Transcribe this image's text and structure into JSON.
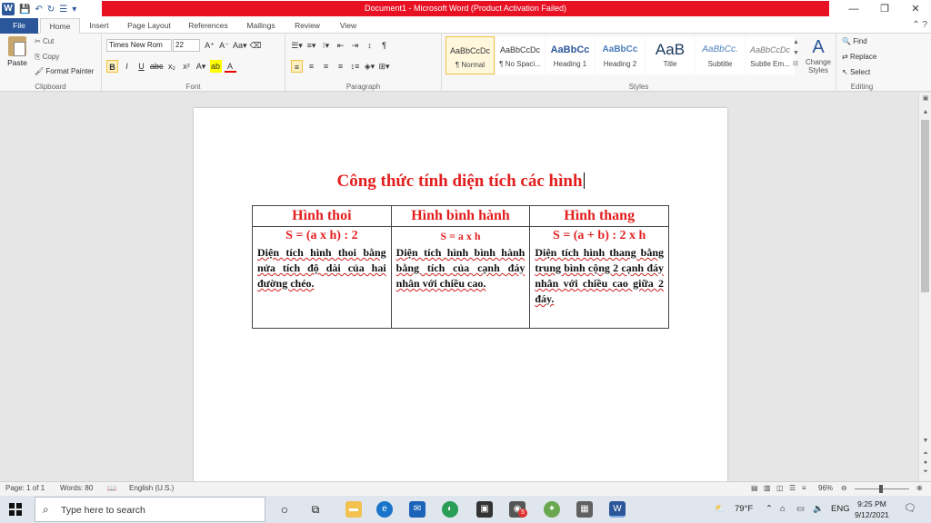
{
  "titlebar": {
    "app_letter": "W",
    "title": "Document1 - Microsoft Word (Product Activation Failed)",
    "controls": {
      "minimize": "—",
      "restore": "❐",
      "close": "✕"
    }
  },
  "tabs": [
    "Home",
    "Insert",
    "Page Layout",
    "References",
    "Mailings",
    "Review",
    "View"
  ],
  "file_tab": "File",
  "ribbon": {
    "clipboard": {
      "label": "Clipboard",
      "paste": "Paste",
      "cut": "Cut",
      "copy": "Copy",
      "format_painter": "Format Painter"
    },
    "font": {
      "label": "Font",
      "font_name": "Times New Rom",
      "font_size": "22"
    },
    "paragraph": {
      "label": "Paragraph"
    },
    "styles": {
      "label": "Styles",
      "items": [
        {
          "preview": "AaBbCcDc",
          "name": "¶ Normal"
        },
        {
          "preview": "AaBbCcDc",
          "name": "¶ No Spaci..."
        },
        {
          "preview": "AaBbCc",
          "name": "Heading 1"
        },
        {
          "preview": "AaBbCc",
          "name": "Heading 2"
        },
        {
          "preview": "AaB",
          "name": "Title"
        },
        {
          "preview": "AaBbCc.",
          "name": "Subtitle"
        },
        {
          "preview": "AaBbCcDc",
          "name": "Subtle Em..."
        }
      ],
      "change_styles_1": "Change",
      "change_styles_2": "Styles"
    },
    "editing": {
      "label": "Editing",
      "find": "Find",
      "replace": "Replace",
      "select": "Select"
    }
  },
  "document": {
    "title": "Công thức tính diện tích các hình",
    "table": {
      "headers": [
        "Hình thoi",
        "Hình bình hành",
        "Hình thang"
      ],
      "formulas": [
        "S = (a x h) : 2",
        "S = a x h",
        "S = (a + b) : 2 x h"
      ],
      "descriptions": [
        "Diện tích hình thoi bằng nửa tích độ dài của hai đường chéo.",
        "Diện tích hình bình hành bằng tích của cạnh đáy nhân với chiều cao.",
        "Diện tích hình thang bằng trung bình cộng 2 cạnh đáy nhân với chiều cao giữa 2 đáy."
      ]
    }
  },
  "statusbar": {
    "page": "Page: 1 of 1",
    "words": "Words: 80",
    "language": "English (U.S.)",
    "zoom": "96%"
  },
  "taskbar": {
    "search_placeholder": "Type here to search",
    "weather": "79°F",
    "lang": "ENG",
    "time": "9:25 PM",
    "date": "9/12/2021",
    "badge": "5"
  }
}
